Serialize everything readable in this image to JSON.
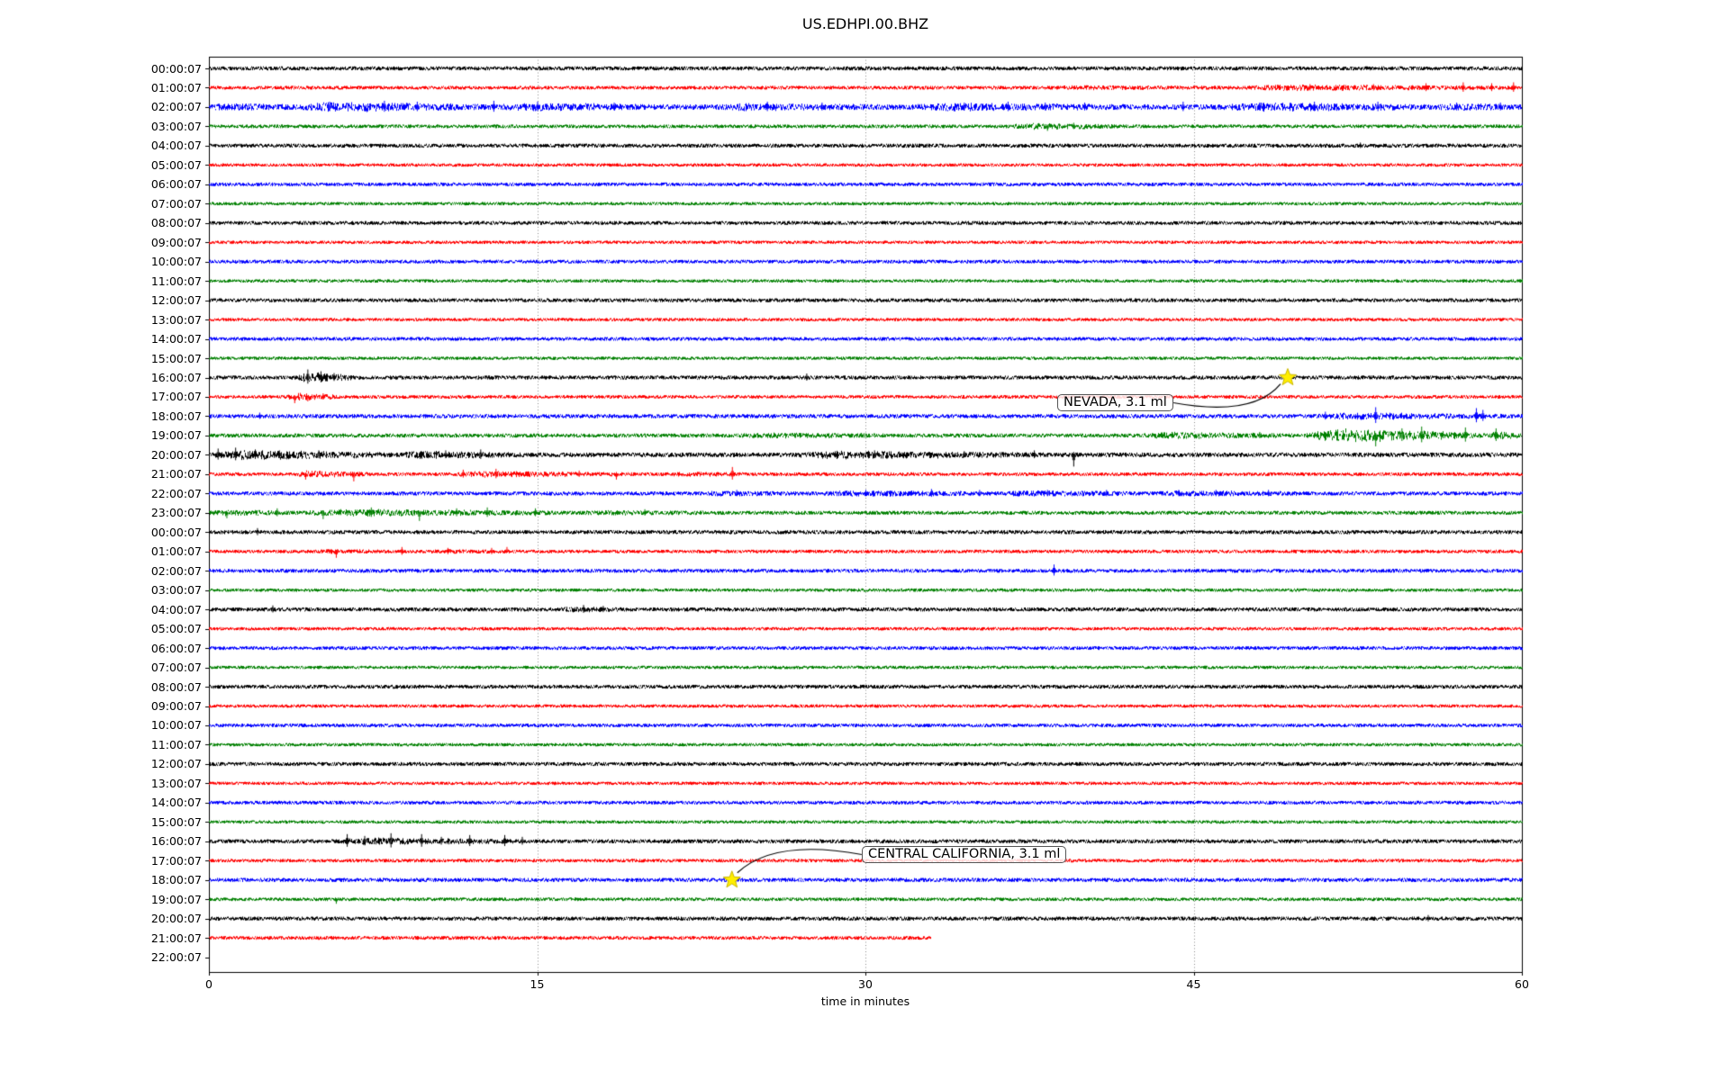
{
  "chart_data": {
    "type": "line",
    "subtype": "seismogram-helicorder",
    "title": "US.EDHPI.00.BHZ",
    "xlabel": "time in minutes",
    "x_range_minutes": [
      0,
      60
    ],
    "x_ticks": [
      "0",
      "15",
      "30",
      "45",
      "60"
    ],
    "grid_minutes": [
      15,
      30,
      45
    ],
    "grid_style": "dotted-vertical",
    "trace_color_cycle": [
      "#000000",
      "#ff0000",
      "#0000ff",
      "#008000"
    ],
    "rows": [
      {
        "label": "00:00:07",
        "color": "#000000",
        "base": 1.7,
        "bursts": [],
        "spikes": []
      },
      {
        "label": "01:00:07",
        "color": "#ff0000",
        "base": 1.5,
        "bursts": [
          [
            38,
            47,
            0.8
          ],
          [
            47,
            60,
            1.8
          ]
        ],
        "spikes": [
          [
            50.3,
            4,
            0
          ],
          [
            53.2,
            4,
            0
          ],
          [
            55.6,
            5,
            0
          ],
          [
            57.3,
            6,
            0
          ],
          [
            58.6,
            5,
            0
          ],
          [
            59.6,
            6,
            0
          ]
        ]
      },
      {
        "label": "02:00:07",
        "color": "#0000ff",
        "base": 2.4,
        "bursts": [
          [
            0,
            4,
            1.5
          ],
          [
            4,
            13,
            3.2
          ],
          [
            13,
            21,
            2.2
          ],
          [
            23,
            31,
            1.8
          ],
          [
            32,
            43,
            2.0
          ],
          [
            46,
            56,
            2.6
          ],
          [
            56,
            60,
            1.5
          ]
        ],
        "spikes": [
          [
            5.5,
            6,
            0
          ],
          [
            8,
            7,
            0
          ],
          [
            9.5,
            6,
            0
          ],
          [
            13,
            7,
            0
          ],
          [
            15,
            6,
            0
          ],
          [
            18.5,
            5,
            0
          ],
          [
            25.5,
            6,
            0
          ],
          [
            28,
            5,
            0
          ],
          [
            34.5,
            5,
            0
          ],
          [
            36.5,
            6,
            0
          ],
          [
            38.2,
            5,
            0
          ],
          [
            40,
            5,
            0
          ],
          [
            44.5,
            6,
            0
          ],
          [
            48,
            5,
            0
          ],
          [
            50.5,
            6,
            0
          ],
          [
            53.4,
            6,
            0
          ],
          [
            57,
            5,
            0
          ],
          [
            59,
            5,
            0
          ]
        ]
      },
      {
        "label": "03:00:07",
        "color": "#008000",
        "base": 1.5,
        "bursts": [
          [
            36.5,
            42,
            2.2
          ]
        ],
        "spikes": [
          [
            38.3,
            5,
            1
          ],
          [
            39.5,
            4,
            0
          ]
        ]
      },
      {
        "label": "04:00:07",
        "color": "#000000",
        "base": 1.7,
        "bursts": [],
        "spikes": [
          [
            52.6,
            3.5,
            0
          ]
        ]
      },
      {
        "label": "05:00:07",
        "color": "#ff0000",
        "base": 1.3,
        "bursts": [],
        "spikes": []
      },
      {
        "label": "06:00:07",
        "color": "#0000ff",
        "base": 1.5,
        "bursts": [],
        "spikes": []
      },
      {
        "label": "07:00:07",
        "color": "#008000",
        "base": 1.3,
        "bursts": [],
        "spikes": []
      },
      {
        "label": "08:00:07",
        "color": "#000000",
        "base": 1.6,
        "bursts": [],
        "spikes": []
      },
      {
        "label": "09:00:07",
        "color": "#ff0000",
        "base": 1.3,
        "bursts": [],
        "spikes": []
      },
      {
        "label": "10:00:07",
        "color": "#0000ff",
        "base": 1.5,
        "bursts": [],
        "spikes": []
      },
      {
        "label": "11:00:07",
        "color": "#008000",
        "base": 1.3,
        "bursts": [],
        "spikes": []
      },
      {
        "label": "12:00:07",
        "color": "#000000",
        "base": 1.6,
        "bursts": [],
        "spikes": []
      },
      {
        "label": "13:00:07",
        "color": "#ff0000",
        "base": 1.3,
        "bursts": [],
        "spikes": []
      },
      {
        "label": "14:00:07",
        "color": "#0000ff",
        "base": 1.5,
        "bursts": [],
        "spikes": []
      },
      {
        "label": "15:00:07",
        "color": "#008000",
        "base": 1.3,
        "bursts": [],
        "spikes": []
      },
      {
        "label": "16:00:07",
        "color": "#000000",
        "base": 1.7,
        "bursts": [
          [
            4.0,
            6.8,
            4.5
          ]
        ],
        "spikes": [
          [
            4.5,
            9,
            0
          ],
          [
            5.1,
            7,
            0
          ],
          [
            5.7,
            5,
            0
          ],
          [
            27.3,
            4.5,
            0
          ]
        ]
      },
      {
        "label": "17:00:07",
        "color": "#ff0000",
        "base": 1.4,
        "bursts": [
          [
            3.5,
            6,
            3.5
          ]
        ],
        "spikes": [
          [
            3.9,
            7,
            1
          ],
          [
            4.5,
            5,
            1
          ],
          [
            5.2,
            4,
            0
          ]
        ]
      },
      {
        "label": "18:00:07",
        "color": "#0000ff",
        "base": 1.8,
        "bursts": [
          [
            50.5,
            59.5,
            2.2
          ]
        ],
        "spikes": [
          [
            2.3,
            4,
            0
          ],
          [
            51,
            5,
            0
          ],
          [
            53.3,
            10,
            0
          ],
          [
            57.9,
            9,
            0
          ],
          [
            58.2,
            7,
            0
          ]
        ]
      },
      {
        "label": "19:00:07",
        "color": "#008000",
        "base": 1.7,
        "bursts": [
          [
            24,
            31,
            1.2
          ],
          [
            42.5,
            50,
            2.2
          ],
          [
            50,
            58.5,
            6.5
          ],
          [
            58.5,
            60,
            3.5
          ]
        ],
        "spikes": [
          [
            29.8,
            3,
            0
          ],
          [
            44,
            4,
            0
          ],
          [
            48,
            4,
            0
          ],
          [
            53.3,
            12,
            1
          ],
          [
            54.5,
            8,
            0
          ],
          [
            55.4,
            10,
            0
          ],
          [
            57.4,
            9,
            0
          ],
          [
            58.8,
            8,
            0
          ]
        ]
      },
      {
        "label": "20:00:07",
        "color": "#000000",
        "base": 2.0,
        "bursts": [
          [
            0,
            8.5,
            3.8
          ],
          [
            8.5,
            14.5,
            2.4
          ],
          [
            26.5,
            38.5,
            2.6
          ]
        ],
        "spikes": [
          [
            0.4,
            7,
            0
          ],
          [
            1.2,
            8,
            0
          ],
          [
            2.1,
            6,
            0
          ],
          [
            3.2,
            5,
            0
          ],
          [
            5.0,
            5,
            0
          ],
          [
            10.8,
            5,
            0
          ],
          [
            12.4,
            6,
            0
          ],
          [
            28.6,
            4,
            0
          ],
          [
            30.4,
            5,
            0
          ],
          [
            34.5,
            4,
            0
          ],
          [
            37.7,
            5,
            0
          ],
          [
            39.5,
            13,
            1
          ]
        ]
      },
      {
        "label": "21:00:07",
        "color": "#ff0000",
        "base": 1.5,
        "bursts": [
          [
            3.8,
            7.5,
            2.6
          ],
          [
            11,
            19.5,
            2.0
          ],
          [
            21,
            24.5,
            1.2
          ]
        ],
        "spikes": [
          [
            4.4,
            6,
            1
          ],
          [
            6.6,
            8,
            1
          ],
          [
            11.6,
            5,
            0
          ],
          [
            13.1,
            6,
            0
          ],
          [
            16.9,
            4,
            0
          ],
          [
            18.6,
            6,
            1
          ],
          [
            23.9,
            8,
            0
          ]
        ]
      },
      {
        "label": "22:00:07",
        "color": "#0000ff",
        "base": 1.7,
        "bursts": [
          [
            22.5,
            27,
            1.2
          ],
          [
            28,
            36,
            1.6
          ],
          [
            36,
            43,
            1.6
          ],
          [
            43,
            50.5,
            1.6
          ]
        ],
        "spikes": [
          [
            24.1,
            4,
            0
          ],
          [
            30,
            4,
            0
          ],
          [
            33,
            5,
            0
          ],
          [
            35.2,
            4,
            0
          ],
          [
            38.3,
            4,
            0
          ],
          [
            41,
            4,
            0
          ],
          [
            44.3,
            4,
            0
          ],
          [
            46,
            4,
            0
          ],
          [
            48.4,
            4,
            0
          ]
        ]
      },
      {
        "label": "23:00:07",
        "color": "#008000",
        "base": 1.6,
        "bursts": [
          [
            0,
            4,
            1.8
          ],
          [
            4,
            16.5,
            2.6
          ],
          [
            16.5,
            24,
            1.0
          ]
        ],
        "spikes": [
          [
            0.8,
            6,
            1
          ],
          [
            3.1,
            5,
            0
          ],
          [
            5.2,
            7,
            1
          ],
          [
            7.4,
            6,
            0
          ],
          [
            9.6,
            9,
            1
          ],
          [
            11.3,
            5,
            0
          ],
          [
            12.7,
            6,
            0
          ],
          [
            14.9,
            5,
            0
          ],
          [
            19.9,
            4,
            0
          ]
        ]
      },
      {
        "label": "00:00:07",
        "color": "#000000",
        "base": 1.7,
        "bursts": [],
        "spikes": [
          [
            2.2,
            4.5,
            0
          ]
        ]
      },
      {
        "label": "01:00:07",
        "color": "#ff0000",
        "base": 1.4,
        "bursts": [
          [
            5,
            8,
            1.2
          ],
          [
            10,
            14,
            0.8
          ]
        ],
        "spikes": [
          [
            5.8,
            7,
            1
          ],
          [
            8.8,
            5,
            0
          ],
          [
            10.9,
            4,
            0
          ],
          [
            12.9,
            4,
            0
          ],
          [
            13.6,
            5,
            -1
          ]
        ]
      },
      {
        "label": "02:00:07",
        "color": "#0000ff",
        "base": 1.6,
        "bursts": [],
        "spikes": [
          [
            38.6,
            7,
            0
          ]
        ]
      },
      {
        "label": "03:00:07",
        "color": "#008000",
        "base": 1.3,
        "bursts": [],
        "spikes": []
      },
      {
        "label": "04:00:07",
        "color": "#000000",
        "base": 1.7,
        "bursts": [
          [
            16,
            19,
            1.4
          ]
        ],
        "spikes": [
          [
            2.9,
            4.5,
            0
          ],
          [
            17.1,
            5,
            0
          ],
          [
            18,
            4,
            0
          ]
        ]
      },
      {
        "label": "05:00:07",
        "color": "#ff0000",
        "base": 1.3,
        "bursts": [],
        "spikes": []
      },
      {
        "label": "06:00:07",
        "color": "#0000ff",
        "base": 1.5,
        "bursts": [],
        "spikes": []
      },
      {
        "label": "07:00:07",
        "color": "#008000",
        "base": 1.3,
        "bursts": [],
        "spikes": []
      },
      {
        "label": "08:00:07",
        "color": "#000000",
        "base": 1.6,
        "bursts": [],
        "spikes": []
      },
      {
        "label": "09:00:07",
        "color": "#ff0000",
        "base": 1.3,
        "bursts": [],
        "spikes": []
      },
      {
        "label": "10:00:07",
        "color": "#0000ff",
        "base": 1.5,
        "bursts": [],
        "spikes": []
      },
      {
        "label": "11:00:07",
        "color": "#008000",
        "base": 1.3,
        "bursts": [],
        "spikes": []
      },
      {
        "label": "12:00:07",
        "color": "#000000",
        "base": 1.6,
        "bursts": [],
        "spikes": []
      },
      {
        "label": "13:00:07",
        "color": "#ff0000",
        "base": 1.3,
        "bursts": [],
        "spikes": []
      },
      {
        "label": "14:00:07",
        "color": "#0000ff",
        "base": 1.5,
        "bursts": [],
        "spikes": []
      },
      {
        "label": "15:00:07",
        "color": "#008000",
        "base": 1.3,
        "bursts": [],
        "spikes": []
      },
      {
        "label": "16:00:07",
        "color": "#000000",
        "base": 1.7,
        "bursts": [
          [
            5.5,
            14.8,
            2.4
          ]
        ],
        "spikes": [
          [
            6.3,
            8,
            0
          ],
          [
            7.1,
            6,
            0
          ],
          [
            8.3,
            9,
            0
          ],
          [
            9.7,
            8,
            0
          ],
          [
            10.6,
            5,
            0
          ],
          [
            11.9,
            7,
            0
          ],
          [
            13.5,
            7,
            0
          ],
          [
            14.3,
            5,
            0
          ]
        ]
      },
      {
        "label": "17:00:07",
        "color": "#ff0000",
        "base": 1.4,
        "bursts": [],
        "spikes": []
      },
      {
        "label": "18:00:07",
        "color": "#0000ff",
        "base": 1.7,
        "bursts": [],
        "spikes": []
      },
      {
        "label": "19:00:07",
        "color": "#008000",
        "base": 1.4,
        "bursts": [],
        "spikes": [
          [
            5.8,
            5,
            1
          ]
        ]
      },
      {
        "label": "20:00:07",
        "color": "#000000",
        "base": 1.7,
        "bursts": [],
        "spikes": [
          [
            55.7,
            4,
            0
          ]
        ]
      },
      {
        "label": "21:00:07",
        "color": "#ff0000",
        "base": 1.5,
        "end_minute": 33,
        "bursts": [],
        "spikes": []
      },
      {
        "label": "22:00:07",
        "color": "#000000",
        "empty": true,
        "base": 0,
        "bursts": [],
        "spikes": []
      }
    ],
    "annotations": [
      {
        "text": "NEVADA, 3.1 ml",
        "row_index": 16,
        "minute": 49.3,
        "marker": "star",
        "marker_color": "#ffee00"
      },
      {
        "text": "CENTRAL CALIFORNIA, 3.1 ml",
        "row_index": 42,
        "minute": 23.9,
        "marker": "star",
        "marker_color": "#ffee00"
      }
    ]
  }
}
